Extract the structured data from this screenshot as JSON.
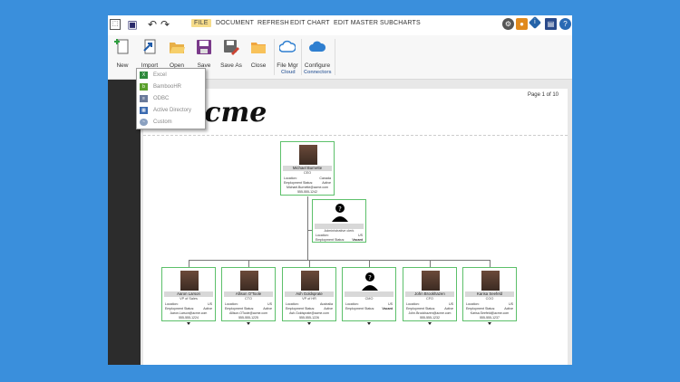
{
  "menu": [
    "FILE",
    "DOCUMENT",
    "REFRESH",
    "EDIT CHART",
    "EDIT MASTER",
    "SUBCHARTS"
  ],
  "ribbon": {
    "buttons": [
      {
        "label": "New",
        "icon": "new-file-icon"
      },
      {
        "label": "Import",
        "icon": "import-icon"
      },
      {
        "label": "Open",
        "icon": "open-folder-icon"
      },
      {
        "label": "Save",
        "icon": "save-icon"
      },
      {
        "label": "Save As",
        "icon": "save-as-icon"
      },
      {
        "label": "Close",
        "icon": "close-folder-icon"
      },
      {
        "label": "File Mgr",
        "icon": "cloud-icon"
      },
      {
        "label": "Configure",
        "icon": "cloud-configure-icon"
      }
    ],
    "groups": [
      "Cloud",
      "Connectors"
    ]
  },
  "import_menu": [
    "Excel",
    "BambooHR",
    "ODBC",
    "Active Directory",
    "Custom"
  ],
  "page": {
    "number": "Page 1 of 10",
    "logo": "Acme"
  },
  "chart": {
    "ceo": {
      "name": "Michael Burnette",
      "title": "CEO",
      "location": "Canada",
      "status": "Active",
      "email": "Michael.Burnette@acme.com",
      "phone": "555-555-1242"
    },
    "assistant": {
      "name": "",
      "title": "Administrative clerk",
      "location": "US",
      "status": "Vacant"
    },
    "reports": [
      {
        "name": "Aaron Larson",
        "title": "VP of Sales",
        "location": "US",
        "status": "Active",
        "email": "Aaron.Larson@acme.com",
        "phone": "555-555-1224"
      },
      {
        "name": "Allison O'Toole",
        "title": "CTO",
        "location": "US",
        "status": "Active",
        "email": "Allison.OToole@acme.com",
        "phone": "555-555-1225"
      },
      {
        "name": "Ash Goldsprate",
        "title": "VP of HR",
        "location": "Australia",
        "status": "Active",
        "email": "Ash.Goldsprate@acme.com",
        "phone": "555-555-1226"
      },
      {
        "name": "",
        "title": "CMO",
        "location": "US",
        "status": "Vacant",
        "email": "",
        "phone": ""
      },
      {
        "name": "John Brookhazen",
        "title": "CFO",
        "location": "US",
        "status": "Active",
        "email": "John.Brookhazen@acme.com",
        "phone": "555-555-1232"
      },
      {
        "name": "Karisa Seefeld",
        "title": "COO",
        "location": "US",
        "status": "Active",
        "email": "Karisa.Seefeld@acme.com",
        "phone": "555-555-1237"
      }
    ],
    "labels": {
      "location": "Location:",
      "status": "Employment Status:"
    }
  },
  "colors": {
    "node_border": "#5cc06a",
    "background": "#3a8fdc",
    "menu_active": "#f6dc8a"
  }
}
